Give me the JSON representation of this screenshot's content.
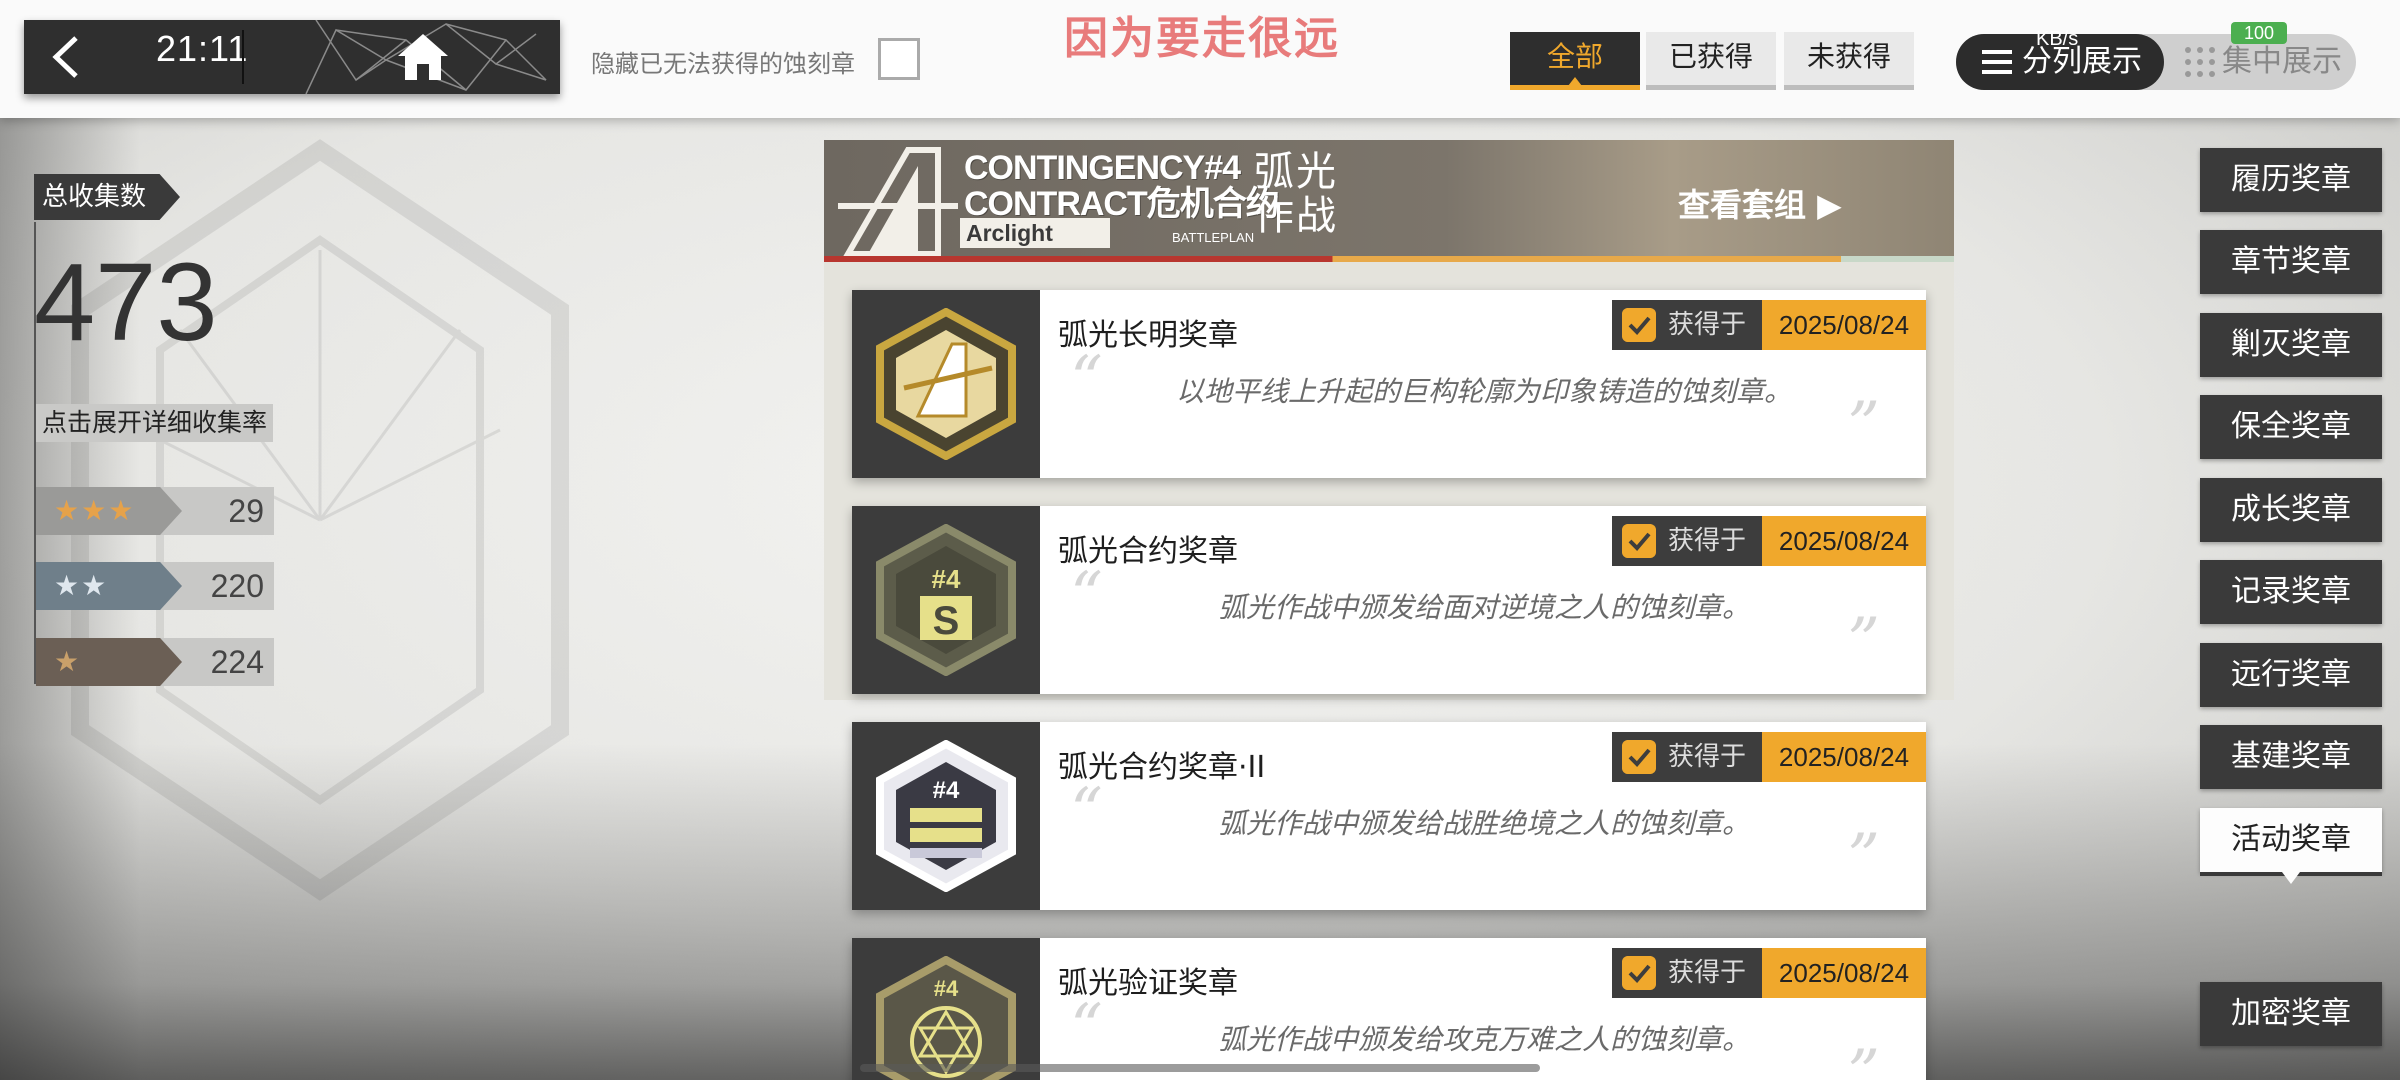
{
  "status": {
    "time": "21:11",
    "net_speed": "KB/s",
    "battery": "100"
  },
  "topbar": {
    "hide_unobtainable_label": "隐藏已无法获得的蚀刻章",
    "overlay_text": "因为要走很远",
    "filters": [
      "全部",
      "已获得",
      "未获得"
    ],
    "active_filter": "全部",
    "view_separate": "分列展示",
    "view_combined": "集中展示"
  },
  "stats": {
    "total_label": "总收集数",
    "total_count": "473",
    "expand_label": "点击展开详细收集率",
    "tiers": [
      {
        "stars": "★★★",
        "count": "29",
        "color": "#e6a24a"
      },
      {
        "stars": "★★",
        "count": "220",
        "color": "#b9c9d6"
      },
      {
        "stars": "★",
        "count": "224",
        "color": "#c9a06a"
      }
    ]
  },
  "banner": {
    "line1": "CONTINGENCY#4",
    "line2": "CONTRACT危机合约",
    "arclight": "Arclight",
    "battleplan": "BATTLEPLAN",
    "cn_title_1": "弧光",
    "cn_title_2": "作战",
    "view_set": "查看套组 ▶"
  },
  "medals": [
    {
      "name": "弧光长明奖章",
      "obtained_label": "获得于",
      "date": "2025/08/24",
      "desc": "以地平线上升起的巨构轮廓为印象铸造的蚀刻章。",
      "icon": "arclight-a-badge-icon",
      "open_quote": "“",
      "close_quote": "”"
    },
    {
      "name": "弧光合约奖章",
      "obtained_label": "获得于",
      "date": "2025/08/24",
      "desc": "弧光作战中颁发给面对逆境之人的蚀刻章。",
      "icon": "contract-s-badge-icon",
      "badge_text": "#4",
      "open_quote": "“",
      "close_quote": "”"
    },
    {
      "name": "弧光合约奖章·II",
      "obtained_label": "获得于",
      "date": "2025/08/24",
      "desc": "弧光作战中颁发给战胜绝境之人的蚀刻章。",
      "icon": "contract-ii-badge-icon",
      "badge_text": "#4",
      "open_quote": "“",
      "close_quote": "”"
    },
    {
      "name": "弧光验证奖章",
      "obtained_label": "获得于",
      "date": "2025/08/24",
      "desc": "弧光作战中颁发给攻克万难之人的蚀刻章。",
      "icon": "verification-badge-icon",
      "badge_text": "#4",
      "open_quote": "“",
      "close_quote": "”"
    }
  ],
  "sidebar": {
    "items": [
      "履历奖章",
      "章节奖章",
      "剿灭奖章",
      "保全奖章",
      "成长奖章",
      "记录奖章",
      "远行奖章",
      "基建奖章",
      "活动奖章"
    ],
    "active": "活动奖章",
    "extra": "加密奖章"
  },
  "colors": {
    "accent": "#f0a82c",
    "dark": "#3a3a3a",
    "overlay": "#e87b7b"
  }
}
